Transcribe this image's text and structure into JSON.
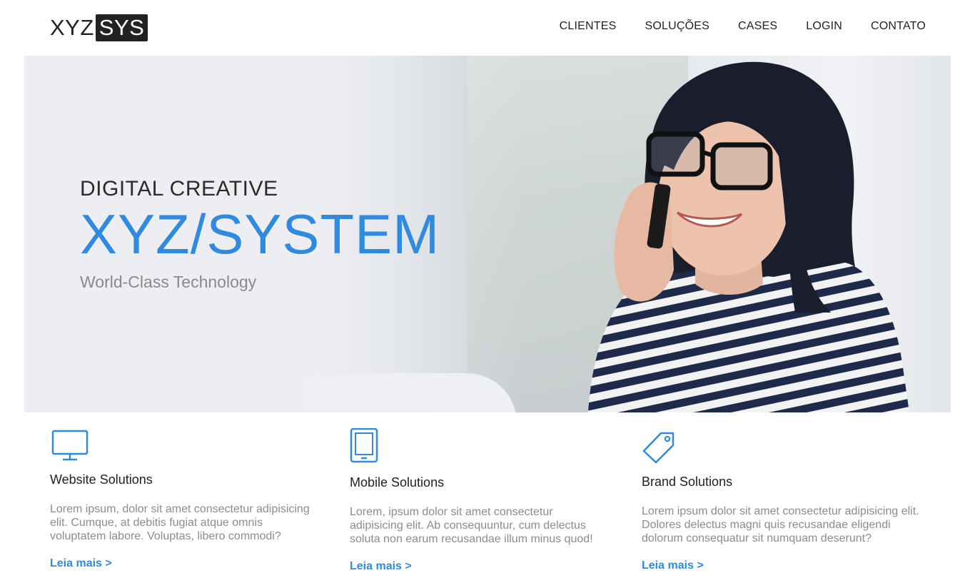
{
  "logo": {
    "part1": "XYZ",
    "part2": "SYS"
  },
  "nav": [
    {
      "label": "CLIENTES"
    },
    {
      "label": "SOLUÇÕES"
    },
    {
      "label": "CASES"
    },
    {
      "label": "LOGIN"
    },
    {
      "label": "CONTATO"
    }
  ],
  "hero": {
    "kicker": "DIGITAL CREATIVE",
    "title": "XYZ/SYSTEM",
    "subtitle": "World-Class Technology",
    "accent_color": "#2f8ae0"
  },
  "features": [
    {
      "icon": "monitor-icon",
      "title": "Website Solutions",
      "text": "Lorem ipsum, dolor sit amet consectetur adipisicing elit. Cumque, at debitis fugiat atque omnis voluptatem labore. Voluptas, libero commodi?",
      "link": "Leia mais >"
    },
    {
      "icon": "tablet-icon",
      "title": "Mobile Solutions",
      "text": "Lorem, ipsum dolor sit amet consectetur adipisicing elit. Ab consequuntur, cum delectus soluta non earum recusandae illum minus quod!",
      "link": "Leia mais >"
    },
    {
      "icon": "price-tag-icon",
      "title": "Brand Solutions",
      "text": "Lorem ipsum dolor sit amet consectetur adipisicing elit. Dolores delectus magni quis recusandae eligendi dolorum consequatur sit numquam deserunt?",
      "link": "Leia mais >"
    }
  ]
}
